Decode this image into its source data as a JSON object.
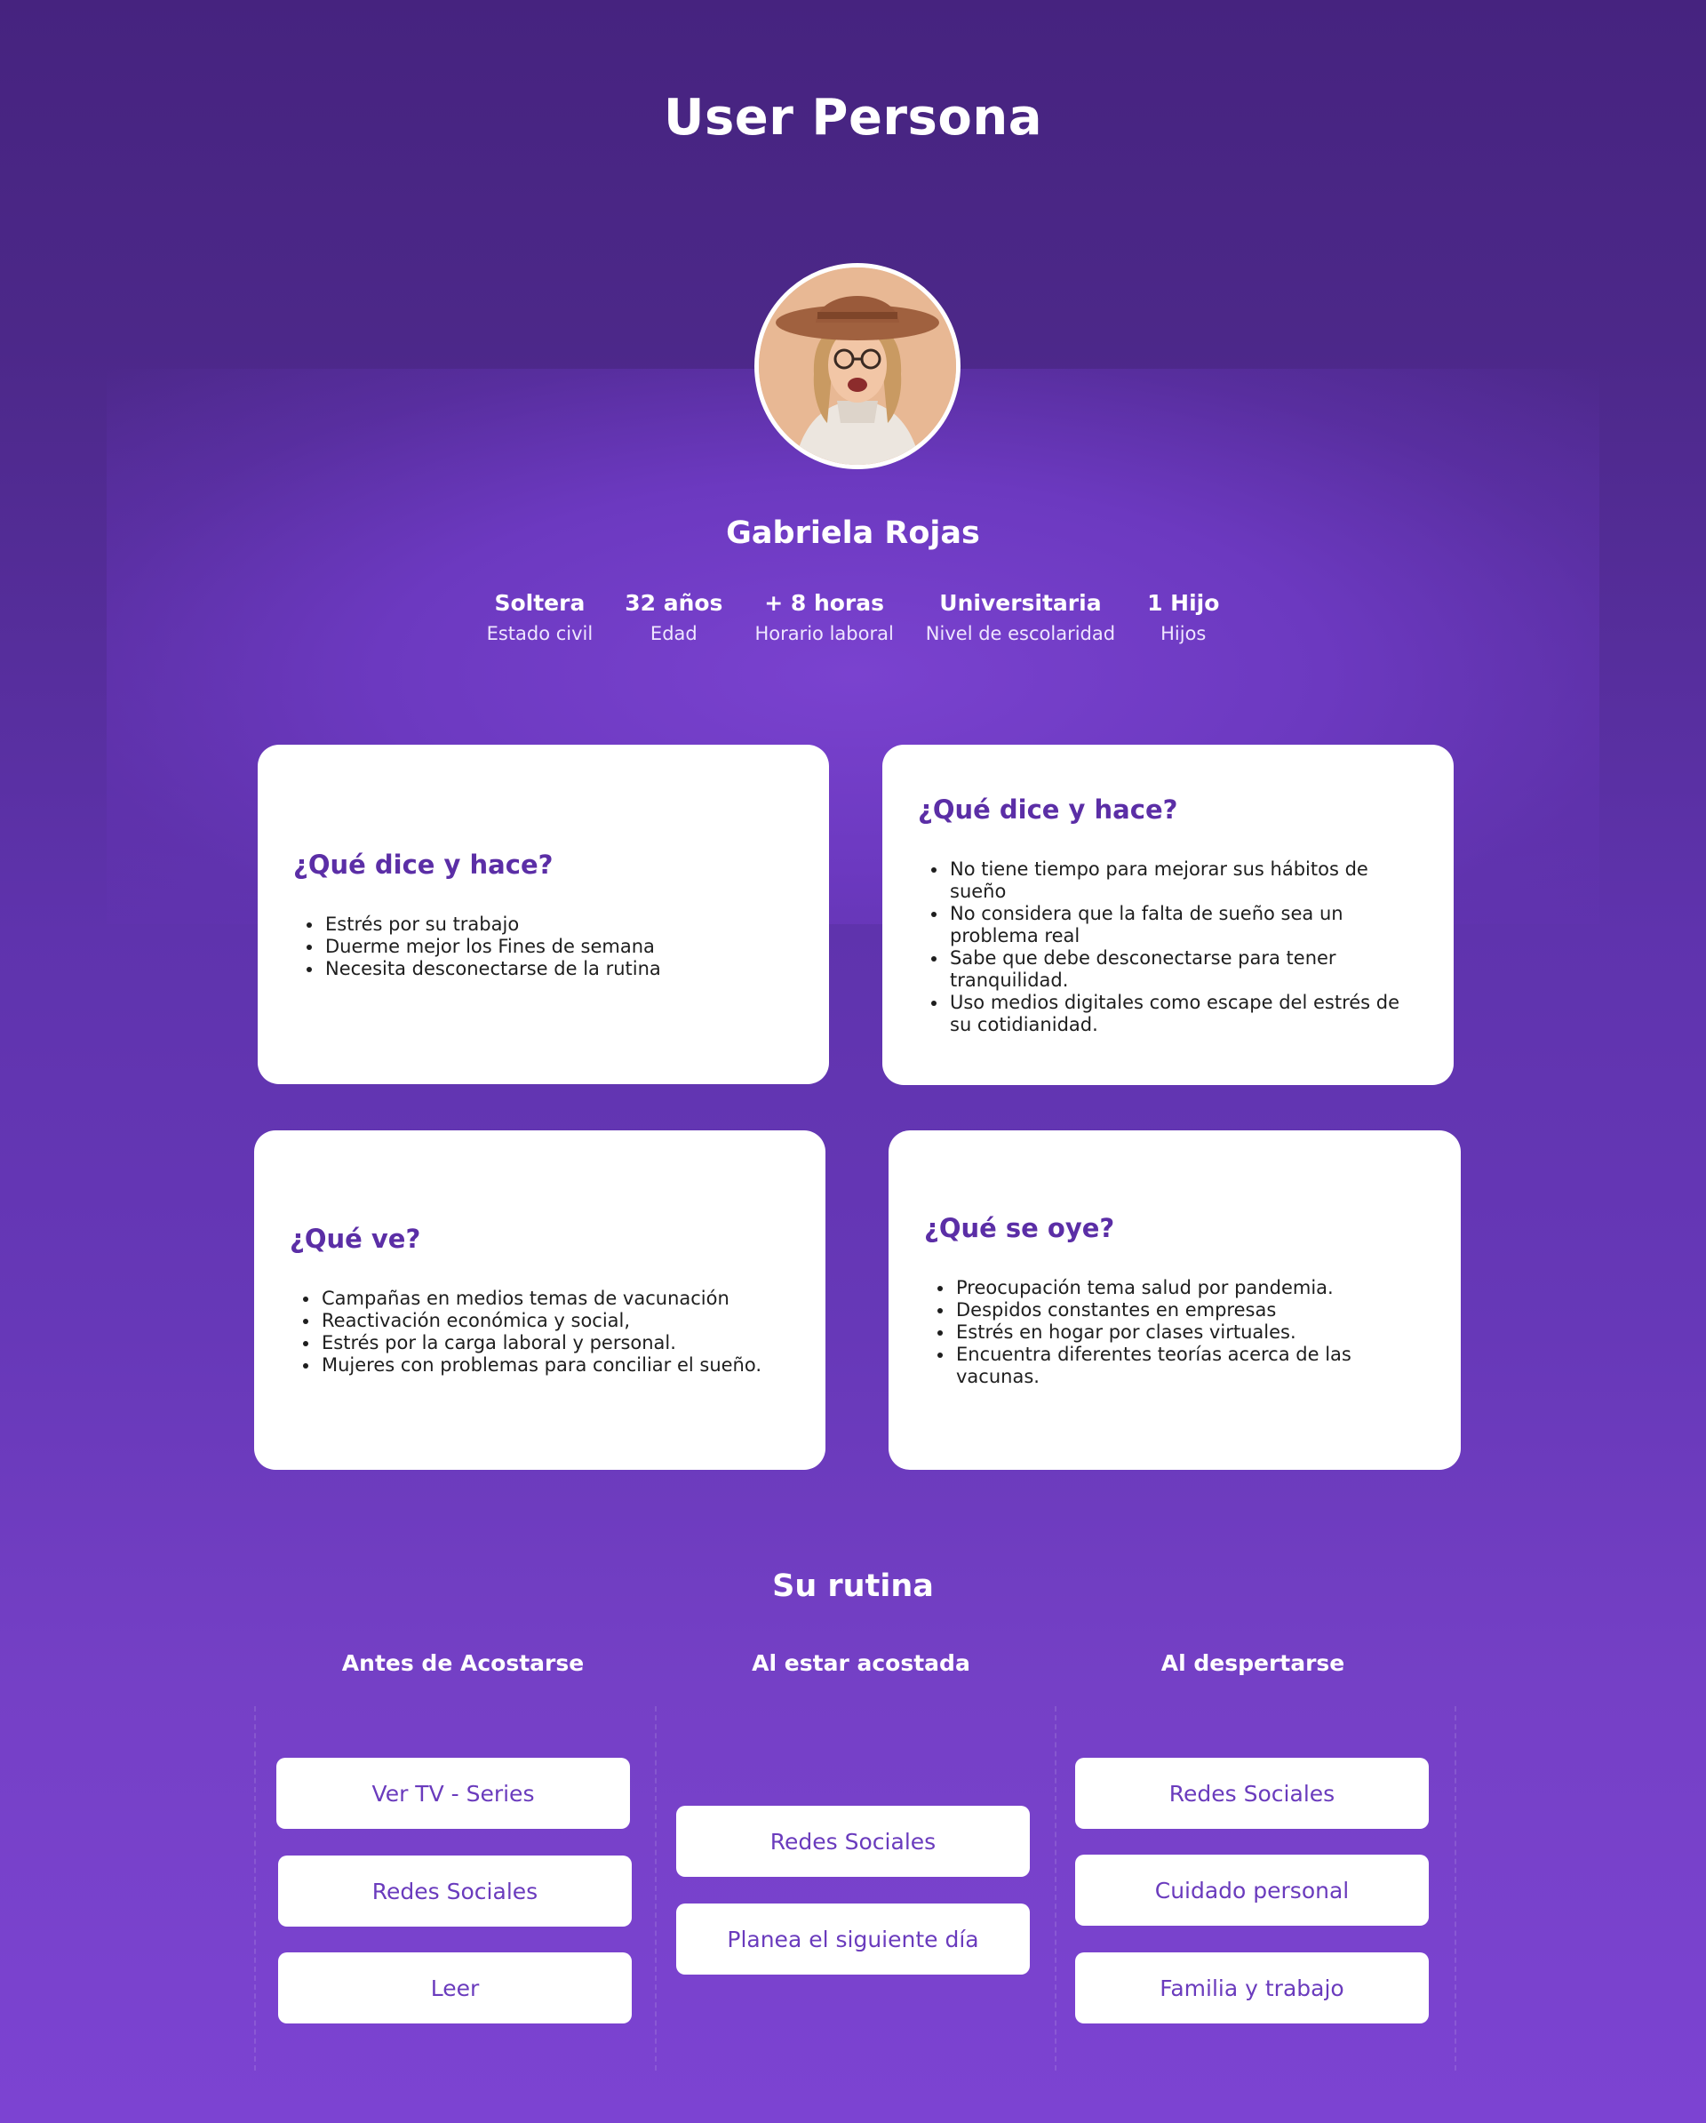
{
  "page": {
    "title": "User Persona"
  },
  "persona": {
    "name": "Gabriela Rojas",
    "stats": [
      {
        "value": "Soltera",
        "label": "Estado civil"
      },
      {
        "value": "32 años",
        "label": "Edad"
      },
      {
        "value": "+ 8 horas",
        "label": "Horario laboral"
      },
      {
        "value": "Universitaria",
        "label": "Nivel de escolaridad"
      },
      {
        "value": "1 Hijo",
        "label": "Hijos"
      }
    ]
  },
  "cards": [
    {
      "title": "¿Qué dice y hace?",
      "items": [
        "Estrés por su trabajo",
        "Duerme mejor los Fines de semana",
        "Necesita desconectarse de la rutina"
      ]
    },
    {
      "title": "¿Qué dice y hace?",
      "items": [
        "No tiene tiempo para mejorar sus hábitos de sueño",
        "No considera que la falta de sueño sea un problema real",
        "Sabe que debe desconectarse para tener tranquilidad.",
        "Uso medios digitales como escape del estrés de su cotidianidad."
      ]
    },
    {
      "title": "¿Qué ve?",
      "items": [
        "Campañas en medios temas de vacunación",
        "Reactivación económica y social,",
        "Estrés por la carga laboral y personal.",
        "Mujeres con problemas para conciliar el sueño."
      ]
    },
    {
      "title": "¿Qué se oye?",
      "items": [
        "Preocupación tema salud por pandemia.",
        "Despidos constantes en empresas",
        "Estrés en hogar por clases virtuales.",
        "Encuentra diferentes teorías acerca de las vacunas."
      ]
    }
  ],
  "routine": {
    "title": "Su rutina",
    "columns": [
      {
        "title": "Antes de Acostarse",
        "items": [
          "Ver TV - Series",
          "Redes Sociales",
          "Leer"
        ]
      },
      {
        "title": "Al estar acostada",
        "items": [
          "Redes Sociales",
          "Planea el siguiente día"
        ]
      },
      {
        "title": "Al despertarse",
        "items": [
          "Redes Sociales",
          "Cuidado personal",
          "Familia y trabajo"
        ]
      }
    ]
  }
}
